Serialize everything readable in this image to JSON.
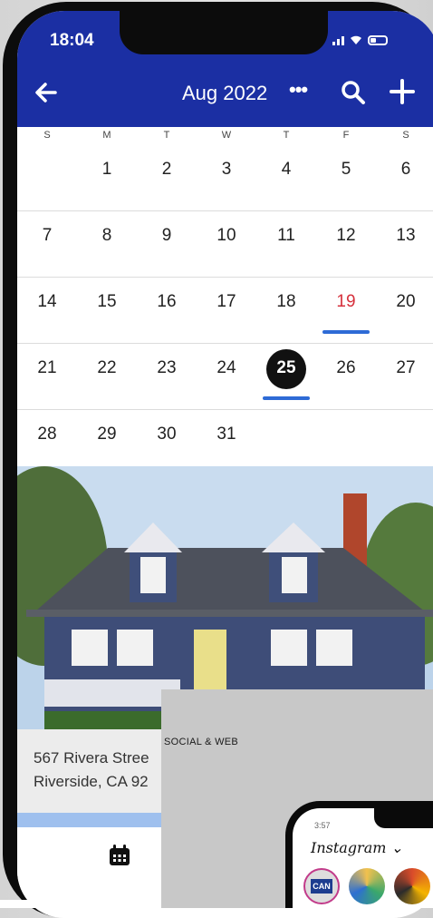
{
  "status": {
    "time": "18:04"
  },
  "header": {
    "month": "Aug 2022",
    "more": "•••"
  },
  "weekdays": [
    "S",
    "M",
    "T",
    "W",
    "T",
    "F",
    "S"
  ],
  "weeks": [
    [
      "",
      "1",
      "2",
      "3",
      "4",
      "5",
      "6"
    ],
    [
      "7",
      "8",
      "9",
      "10",
      "11",
      "12",
      "13"
    ],
    [
      "14",
      "15",
      "16",
      "17",
      "18",
      "19",
      "20"
    ],
    [
      "21",
      "22",
      "23",
      "24",
      "25",
      "26",
      "27"
    ],
    [
      "28",
      "29",
      "30",
      "31",
      "",
      "",
      ""
    ]
  ],
  "highlight": {
    "today": "19",
    "selected": "25"
  },
  "address": {
    "line1": "567 Rivera Stree",
    "line2": "Riverside, CA 92"
  },
  "overlay": {
    "label": "SOCIAL & WEB",
    "ig_time": "3:57",
    "ig_title": "Instagram ⌄",
    "story_label": "CAN"
  },
  "colors": {
    "header": "#1b2fa3",
    "accent_underline": "#2e6bd6",
    "today_red": "#d6303c"
  }
}
